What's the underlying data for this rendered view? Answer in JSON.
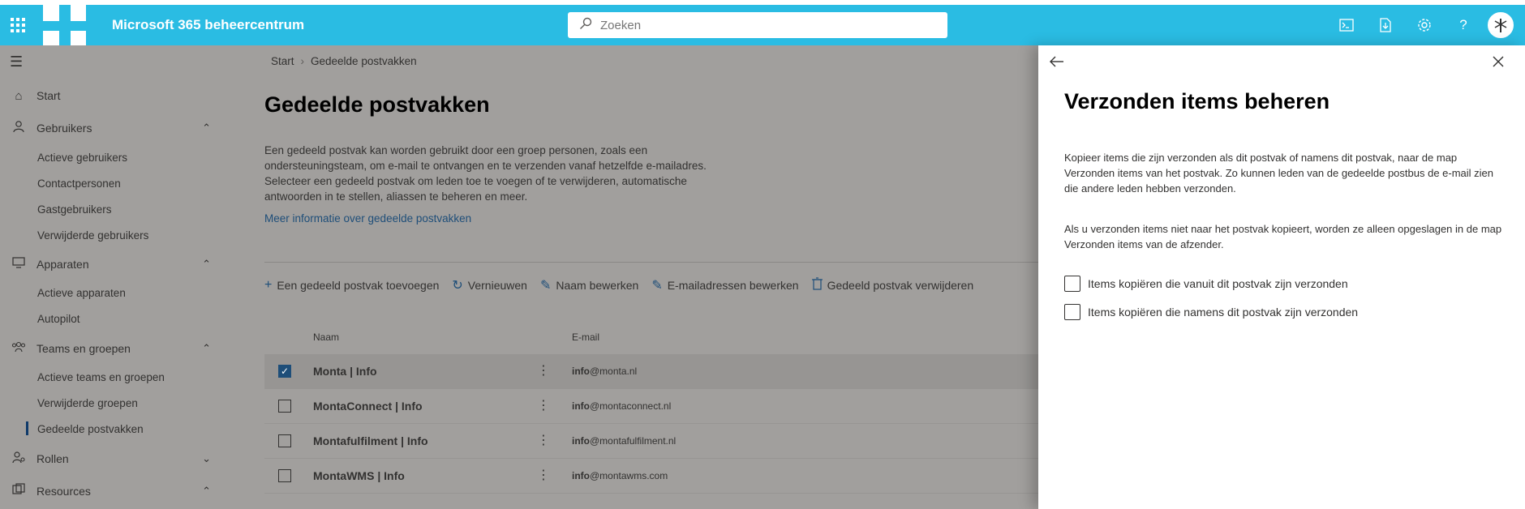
{
  "header": {
    "app_title": "Microsoft 365 beheercentrum",
    "search_placeholder": "Zoeken",
    "brand_color": "#2abce3"
  },
  "sidebar": {
    "items": [
      {
        "label": "Start",
        "icon": "home-icon"
      },
      {
        "label": "Gebruikers",
        "icon": "person-icon"
      },
      {
        "label": "Actieve gebruikers"
      },
      {
        "label": "Contactpersonen"
      },
      {
        "label": "Gastgebruikers"
      },
      {
        "label": "Verwijderde gebruikers"
      },
      {
        "label": "Apparaten",
        "icon": "devices-icon"
      },
      {
        "label": "Actieve apparaten"
      },
      {
        "label": "Autopilot"
      },
      {
        "label": "Teams en groepen",
        "icon": "teams-icon"
      },
      {
        "label": "Actieve teams en groepen"
      },
      {
        "label": "Verwijderde groepen"
      },
      {
        "label": "Gedeelde postvakken"
      },
      {
        "label": "Rollen",
        "icon": "roles-icon"
      },
      {
        "label": "Resources",
        "icon": "resources-icon"
      }
    ]
  },
  "main": {
    "breadcrumb": {
      "home": "Start",
      "current": "Gedeelde postvakken"
    },
    "title": "Gedeelde postvakken",
    "description": "Een gedeeld postvak kan worden gebruikt door een groep personen, zoals een ondersteuningsteam, om e-mail te ontvangen en te verzenden vanaf hetzelfde e-mailadres. Selecteer een gedeeld postvak om leden toe te voegen of te verwijderen, automatische antwoorden in te stellen, aliassen te beheren en meer.",
    "more_link": "Meer informatie over gedeelde postvakken",
    "toolbar": {
      "add": "Een gedeeld postvak toevoegen",
      "refresh": "Vernieuwen",
      "edit_name": "Naam bewerken",
      "edit_email": "E-mailadressen bewerken",
      "delete": "Gedeeld postvak verwijderen"
    },
    "columns": {
      "name": "Naam",
      "email": "E-mail"
    },
    "rows": [
      {
        "name": "Monta | Info",
        "email_user": "info",
        "email_domain": "@monta.nl",
        "selected": true
      },
      {
        "name": "MontaConnect | Info",
        "email_user": "info",
        "email_domain": "@montaconnect.nl",
        "selected": false
      },
      {
        "name": "Montafulfilment | Info",
        "email_user": "info",
        "email_domain": "@montafulfilment.nl",
        "selected": false
      },
      {
        "name": "MontaWMS | Info",
        "email_user": "info",
        "email_domain": "@montawms.com",
        "selected": false
      }
    ]
  },
  "panel": {
    "title": "Verzonden items beheren",
    "paragraph1": "Kopieer items die zijn verzonden als dit postvak of namens dit postvak, naar de map Verzonden items van het postvak. Zo kunnen leden van de gedeelde postbus de e-mail zien die andere leden hebben verzonden.",
    "paragraph2": "Als u verzonden items niet naar het postvak kopieert, worden ze alleen opgeslagen in de map Verzonden items van de afzender.",
    "option1": "Items kopiëren die vanuit dit postvak zijn verzonden",
    "option2": "Items kopiëren die namens dit postvak zijn verzonden"
  }
}
